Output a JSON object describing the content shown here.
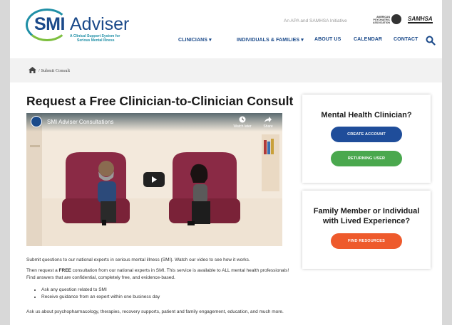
{
  "header": {
    "logo_smi": "SMI",
    "logo_adviser": "Adviser",
    "logo_tagline_1": "A Clinical Support System for",
    "logo_tagline_2": "Serious Mental Illness",
    "initiative": "An APA and SAMHSA Initiative",
    "apa_text": "AMERICAN PSYCHIATRIC ASSOCIATION",
    "samhsa": "SAMHSA"
  },
  "nav": {
    "items": [
      {
        "label": "CLINICIANS",
        "has_dropdown": true
      },
      {
        "label": "INDIVIDUALS & FAMILIES",
        "has_dropdown": true
      },
      {
        "label": "ABOUT US"
      },
      {
        "label": "CALENDAR"
      },
      {
        "label": "CONTACT"
      }
    ],
    "dropdown_glyph": "▾"
  },
  "breadcrumb": {
    "separator": "/",
    "current": "Submit Consult"
  },
  "main": {
    "title": "Request a Free Clinician-to-Clinician Consult",
    "video": {
      "title": "SMI Adviser Consultations",
      "watch_later": "Watch later",
      "share": "Share"
    },
    "para1": "Submit questions to our national experts in serious mental illness (SMI). Watch our video to see how it works.",
    "para2_pre": "Then request a ",
    "para2_bold": "FREE",
    "para2_post": " consultation from our national experts in SMI. This service is available to ALL mental health professionals! Find answers that are confidential, completely free, and evidence-based.",
    "bullets": [
      "Ask any question related to SMI",
      "Receive guidance from an expert within one business day"
    ],
    "para3": "Ask us about psychopharmacology, therapies, recovery supports, patient and family engagement, education, and much more."
  },
  "sidebar": {
    "clinician_title": "Mental Health Clinician?",
    "create_account": "CREATE ACCOUNT",
    "returning_user": "RETURNING USER",
    "family_title": "Family Member or Individual with Lived Experience?",
    "find_resources": "FIND RESOURCES"
  },
  "colors": {
    "brand_blue": "#1b4a8a",
    "button_blue": "#1f4d9a",
    "button_green": "#4aa84e",
    "button_orange": "#ee5a2c"
  }
}
